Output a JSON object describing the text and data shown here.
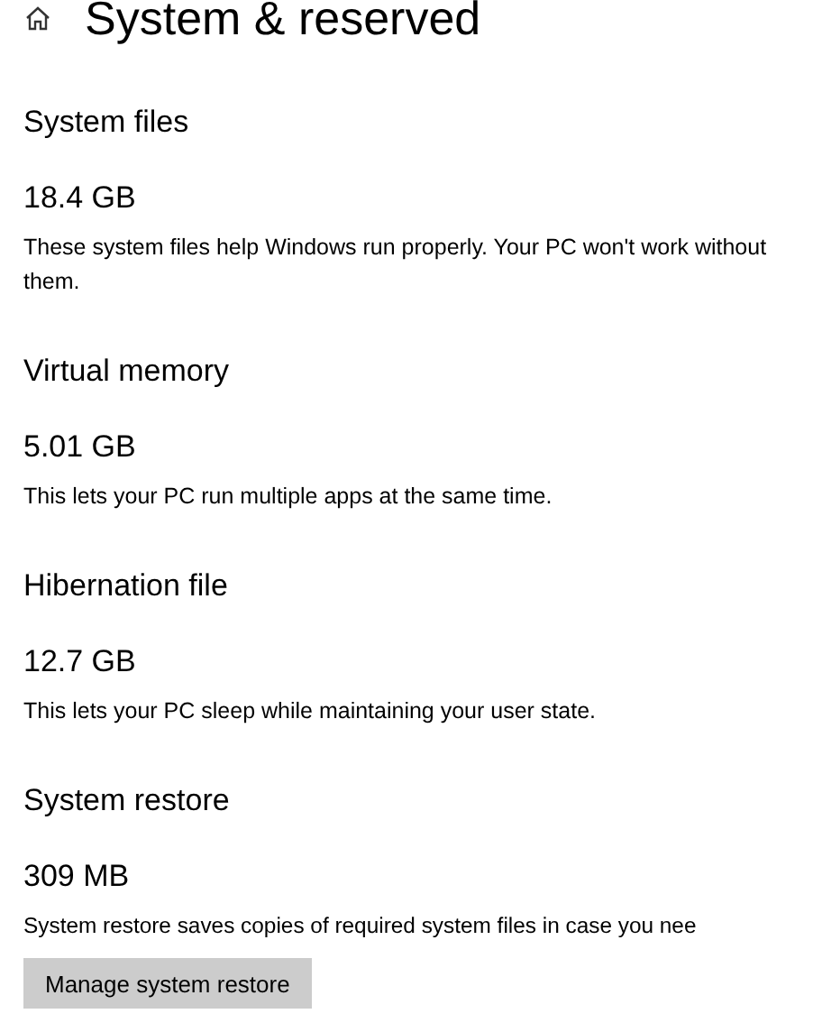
{
  "page": {
    "title": "System & reserved"
  },
  "sections": [
    {
      "heading": "System files",
      "size": "18.4 GB",
      "description": "These system files help Windows run properly. Your PC won't work without them."
    },
    {
      "heading": "Virtual memory",
      "size": "5.01 GB",
      "description": "This lets your PC run multiple apps at the same time."
    },
    {
      "heading": "Hibernation file",
      "size": "12.7 GB",
      "description": "This lets your PC sleep while maintaining your user state."
    },
    {
      "heading": "System restore",
      "size": "309 MB",
      "description": "System restore saves copies of required system files in case you nee",
      "button": "Manage system restore"
    }
  ]
}
